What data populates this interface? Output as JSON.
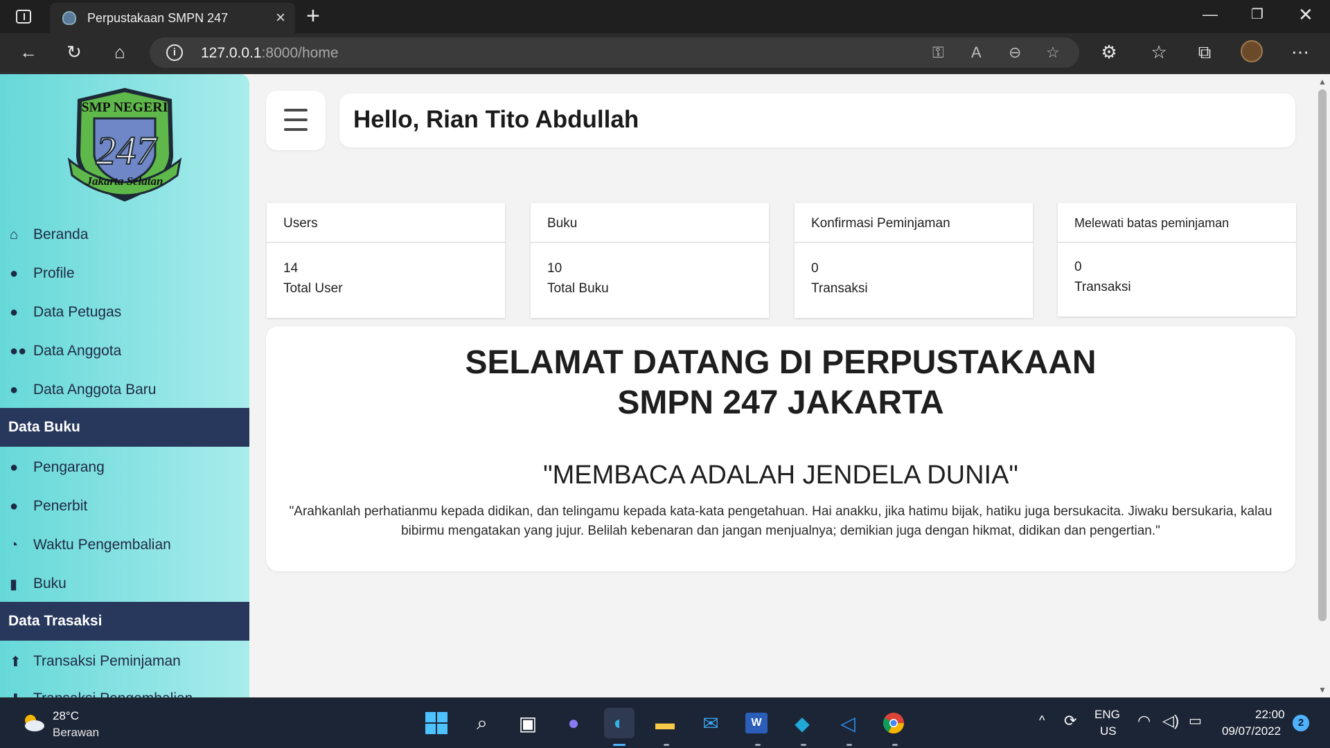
{
  "browser": {
    "tab_title": "Perpustakaan SMPN 247",
    "url_host": "127.0.0.1",
    "url_rest": ":8000/home"
  },
  "sidebar": {
    "items_top": [
      {
        "label": "Beranda",
        "icon": "home-icon"
      },
      {
        "label": "Profile",
        "icon": "user-icon"
      },
      {
        "label": "Data Petugas",
        "icon": "user-tie-icon"
      },
      {
        "label": "Data Anggota",
        "icon": "users-icon"
      },
      {
        "label": "Data Anggota Baru",
        "icon": "user-icon"
      }
    ],
    "section_buku": "Data Buku",
    "items_buku": [
      {
        "label": "Pengarang",
        "icon": "user-check-icon"
      },
      {
        "label": "Penerbit",
        "icon": "user-cog-icon"
      },
      {
        "label": "Waktu Pengembalian",
        "icon": "clock-icon"
      },
      {
        "label": "Buku",
        "icon": "book-icon"
      }
    ],
    "section_transaksi": "Data Trasaksi",
    "items_transaksi": [
      {
        "label": "Transaksi Peminjaman",
        "icon": "arrow-circle-up-icon"
      },
      {
        "label": "Transaksi Pengembalian",
        "icon": "arrow-circle-down-icon"
      }
    ]
  },
  "header": {
    "greeting": "Hello, Rian Tito Abdullah"
  },
  "cards": [
    {
      "title": "Users",
      "value": "14",
      "label": "Total User"
    },
    {
      "title": "Buku",
      "value": "10",
      "label": "Total Buku"
    },
    {
      "title": "Konfirmasi Peminjaman",
      "value": "0",
      "label": "Transaksi"
    },
    {
      "title": "Melewati batas peminjaman",
      "value": "0",
      "label": "Transaksi"
    }
  ],
  "welcome": {
    "title_line1": "SELAMAT DATANG DI PERPUSTAKAAN",
    "title_line2": "SMPN 247 JAKARTA",
    "motto": "\"MEMBACA ADALAH JENDELA DUNIA\"",
    "quote": "\"Arahkanlah perhatianmu kepada didikan, dan telingamu kepada kata-kata pengetahuan. Hai anakku, jika hatimu bijak, hatiku juga bersukacita. Jiwaku bersukaria, kalau bibirmu mengatakan yang jujur. Belilah kebenaran dan jangan menjualnya; demikian juga dengan hikmat, didikan dan pengertian.\""
  },
  "logo": {
    "top_text": "SMP NEGERI",
    "number": "247",
    "bottom_text": "Jakarta Selatan"
  },
  "taskbar": {
    "temperature": "28°C",
    "condition": "Berawan",
    "lang_line1": "ENG",
    "lang_line2": "US",
    "time": "22:00",
    "date": "09/07/2022",
    "notifications": "2"
  }
}
